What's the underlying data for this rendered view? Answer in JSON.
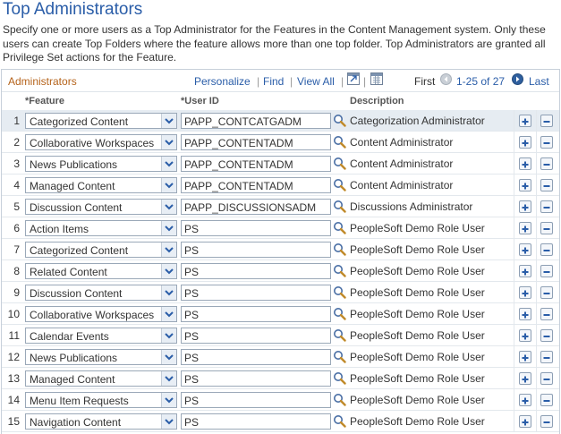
{
  "page": {
    "title": "Top Administrators",
    "intro": "Specify one or more users as a Top Administrator for the Features in the Content Management system. Only these users can create Top Folders where the feature allows more than one top folder. Top Administrators are granted all Privilege Set actions for the Feature."
  },
  "grid": {
    "caption": "Administrators",
    "personalize": "Personalize",
    "find": "Find",
    "view_all": "View All",
    "sep": "|",
    "first": "First",
    "range": "1-25 of 27",
    "last": "Last",
    "col_feature": "*Feature",
    "col_userid": "*User ID",
    "col_description": "Description",
    "rows": [
      {
        "num": "1",
        "feature": "Categorized Content",
        "user": "PAPP_CONTCATGADM",
        "desc": "Categorization Administrator"
      },
      {
        "num": "2",
        "feature": "Collaborative Workspaces",
        "user": "PAPP_CONTENTADM",
        "desc": "Content Administrator"
      },
      {
        "num": "3",
        "feature": "News Publications",
        "user": "PAPP_CONTENTADM",
        "desc": "Content Administrator"
      },
      {
        "num": "4",
        "feature": "Managed Content",
        "user": "PAPP_CONTENTADM",
        "desc": "Content Administrator"
      },
      {
        "num": "5",
        "feature": "Discussion Content",
        "user": "PAPP_DISCUSSIONSADM",
        "desc": "Discussions Administrator"
      },
      {
        "num": "6",
        "feature": "Action Items",
        "user": "PS",
        "desc": "PeopleSoft Demo Role User"
      },
      {
        "num": "7",
        "feature": "Categorized Content",
        "user": "PS",
        "desc": "PeopleSoft Demo Role User"
      },
      {
        "num": "8",
        "feature": "Related Content",
        "user": "PS",
        "desc": "PeopleSoft Demo Role User"
      },
      {
        "num": "9",
        "feature": "Discussion Content",
        "user": "PS",
        "desc": "PeopleSoft Demo Role User"
      },
      {
        "num": "10",
        "feature": "Collaborative Workspaces",
        "user": "PS",
        "desc": "PeopleSoft Demo Role User"
      },
      {
        "num": "11",
        "feature": "Calendar Events",
        "user": "PS",
        "desc": "PeopleSoft Demo Role User"
      },
      {
        "num": "12",
        "feature": "News Publications",
        "user": "PS",
        "desc": "PeopleSoft Demo Role User"
      },
      {
        "num": "13",
        "feature": "Managed Content",
        "user": "PS",
        "desc": "PeopleSoft Demo Role User"
      },
      {
        "num": "14",
        "feature": "Menu Item Requests",
        "user": "PS",
        "desc": "PeopleSoft Demo Role User"
      },
      {
        "num": "15",
        "feature": "Navigation Content",
        "user": "PS",
        "desc": "PeopleSoft Demo Role User"
      }
    ]
  },
  "icons": {
    "zoom": "zoom-grid-icon",
    "download": "download-grid-icon",
    "prev": "previous-page-icon",
    "dropdown": "chevron-down-icon",
    "lookup": "lookup-magnifier-icon",
    "add": "plus-icon",
    "delete": "minus-icon"
  },
  "colors": {
    "title": "#2a5da8",
    "caption": "#b5631b",
    "link": "#2a5da8",
    "selected_row": "#e6ecf2"
  }
}
